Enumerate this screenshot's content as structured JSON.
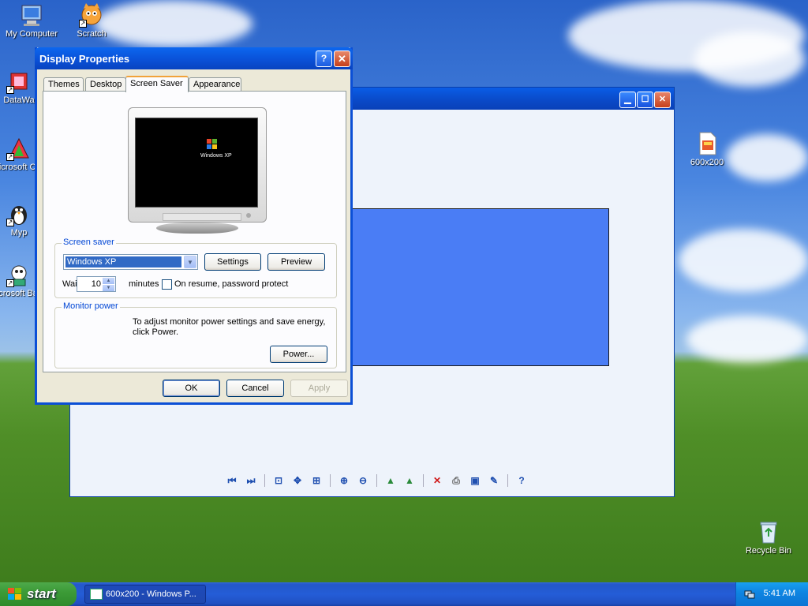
{
  "desktop": {
    "icons": [
      {
        "label": "My Computer"
      },
      {
        "label": "Scratch"
      },
      {
        "label": "DataWa"
      },
      {
        "label": "Microsoft C++"
      },
      {
        "label": "Myp"
      },
      {
        "label": "Microsoft Basic"
      },
      {
        "label": "600x200"
      },
      {
        "label": "Recycle Bin"
      }
    ]
  },
  "dialog": {
    "title": "Display Properties",
    "help_label": "?",
    "close_label": "✕",
    "tabs": [
      {
        "label": "Themes"
      },
      {
        "label": "Desktop"
      },
      {
        "label": "Screen Saver",
        "active": true
      },
      {
        "label": "Appearance"
      }
    ],
    "preview_logo_text": "Windows XP",
    "screen_saver": {
      "legend": "Screen saver",
      "selected": "Windows XP",
      "settings_label": "Settings",
      "preview_label": "Preview",
      "wait_label": "Wait:",
      "wait_value": "10",
      "minutes_label": "minutes",
      "password_label": "On resume, password protect",
      "password_checked": false
    },
    "monitor_power": {
      "legend": "Monitor power",
      "text": "To adjust monitor power settings and save energy, click Power.",
      "power_label": "Power..."
    },
    "buttons": {
      "ok": "OK",
      "cancel": "Cancel",
      "apply": "Apply"
    }
  },
  "taskbar": {
    "start_label": "start",
    "task_label": "600x200 - Windows P...",
    "clock": "5:41 AM"
  },
  "colors": {
    "title_blue": "#0a51d8",
    "image_blue": "#4a7df5",
    "start_green": "#3c9b37"
  }
}
